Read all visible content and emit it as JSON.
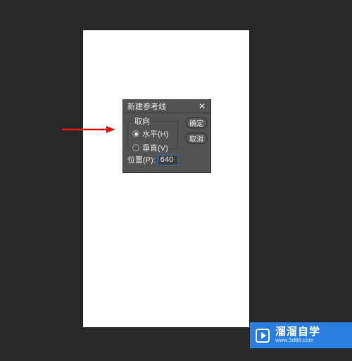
{
  "dialog": {
    "title": "新建参考线",
    "close": "✕",
    "orientation_legend": "取向",
    "radio_horizontal": "水平(H)",
    "radio_vertical": "垂直(V)",
    "ok_label": "确定",
    "cancel_label": "取消",
    "position_label": "位置(P):",
    "position_value": "640"
  },
  "banner": {
    "main_text": "溜溜自学",
    "sub_text": "www.3d66.com"
  }
}
